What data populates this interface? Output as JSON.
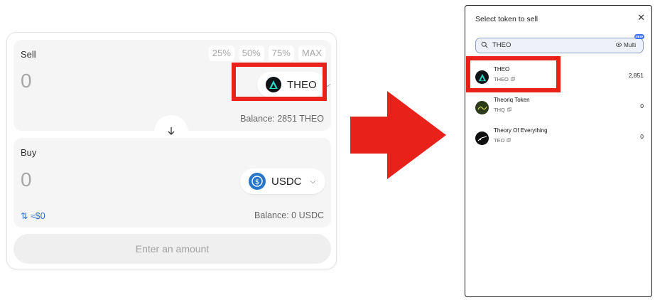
{
  "swap": {
    "sell": {
      "label": "Sell",
      "percent_buttons": [
        "25%",
        "50%",
        "75%",
        "MAX"
      ],
      "amount": "0",
      "token": "THEO",
      "balance": "Balance: 2851 THEO"
    },
    "buy": {
      "label": "Buy",
      "amount": "0",
      "token": "USDC",
      "rate": "⇅ ≈$0",
      "balance": "Balance: 0 USDC"
    },
    "action_label": "Enter an amount"
  },
  "modal": {
    "title": "Select token to sell",
    "close_glyph": "✕",
    "search": {
      "value": "THEO",
      "multi_label": "Multi",
      "badge": "NEW"
    },
    "tokens": [
      {
        "name": "THEO",
        "symbol": "THEO",
        "balance": "2,851"
      },
      {
        "name": "Theoriq Token",
        "symbol": "THQ",
        "balance": "0"
      },
      {
        "name": "Theory Of Everything",
        "symbol": "TEO",
        "balance": "0"
      }
    ]
  },
  "colors": {
    "highlight": "#e8211a",
    "accent": "#2f6fd6",
    "usdc": "#2775ca"
  },
  "icons": {
    "swap_direction": "arrow-down-icon",
    "search": "search-icon",
    "copy": "copy-icon",
    "close": "close-icon",
    "chevron": "chevron-down-icon"
  }
}
